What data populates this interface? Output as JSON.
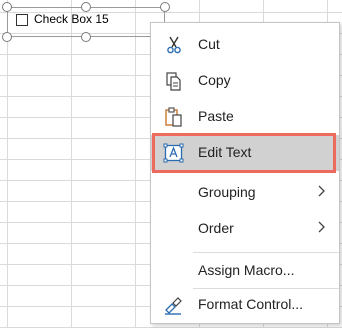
{
  "sheet": {
    "checkbox_label": "Check Box 15"
  },
  "context_menu": {
    "items": [
      {
        "label": "Cut",
        "icon": "scissors-icon"
      },
      {
        "label": "Copy",
        "icon": "copy-icon"
      },
      {
        "label": "Paste",
        "icon": "clipboard-paste-icon"
      },
      {
        "label": "Edit Text",
        "icon": "text-box-icon",
        "highlighted": true
      },
      {
        "label": "Grouping",
        "submenu": true
      },
      {
        "label": "Order",
        "submenu": true
      },
      {
        "label": "Assign Macro..."
      },
      {
        "label": "Format Control...",
        "icon": "format-control-icon"
      }
    ]
  },
  "colors": {
    "highlight_fill": "#d1d1d1",
    "highlight_border": "#ee6a5e",
    "icon_blue": "#2b6cb0",
    "icon_orange": "#c9772d"
  }
}
